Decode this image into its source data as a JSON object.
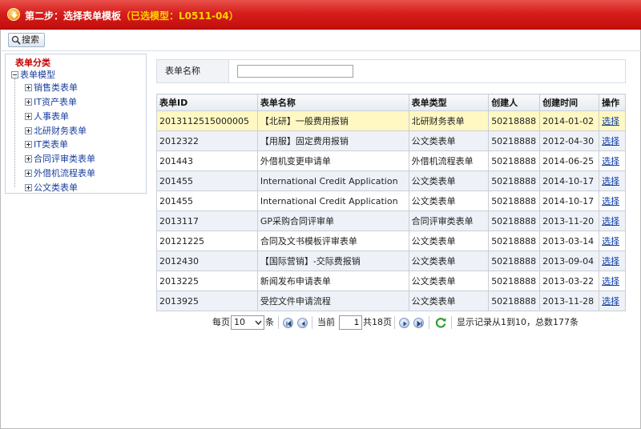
{
  "header": {
    "title": "第二步：选择表单模板",
    "selected_model": "（已选模型：L0511-04）"
  },
  "toolbar": {
    "search_label": "搜索"
  },
  "tree": {
    "title": "表单分类",
    "root": "表单模型",
    "items": [
      "销售类表单",
      "IT资产表单",
      "人事表单",
      "北研财务表单",
      "IT类表单",
      "合同评审类表单",
      "外借机流程表单",
      "公文类表单"
    ]
  },
  "filter": {
    "label": "表单名称",
    "value": ""
  },
  "table": {
    "columns": [
      "表单ID",
      "表单名称",
      "表单类型",
      "创建人",
      "创建时间",
      "操作"
    ],
    "rows": [
      {
        "id": "2013112515000005",
        "name": "【北研】一般费用报销",
        "type": "北研财务表单",
        "creator": "50218888",
        "time": "2014-01-02",
        "action": "选择"
      },
      {
        "id": "2012322",
        "name": "【用服】固定费用报销",
        "type": "公文类表单",
        "creator": "50218888",
        "time": "2012-04-30",
        "action": "选择"
      },
      {
        "id": "201443",
        "name": "外借机变更申请单",
        "type": "外借机流程表单",
        "creator": "50218888",
        "time": "2014-06-25",
        "action": "选择"
      },
      {
        "id": "201455",
        "name": "International Credit Application",
        "type": "公文类表单",
        "creator": "50218888",
        "time": "2014-10-17",
        "action": "选择"
      },
      {
        "id": "201455",
        "name": "International Credit Application",
        "type": "公文类表单",
        "creator": "50218888",
        "time": "2014-10-17",
        "action": "选择"
      },
      {
        "id": "2013117",
        "name": "GP采购合同评审单",
        "type": "合同评审类表单",
        "creator": "50218888",
        "time": "2013-11-20",
        "action": "选择"
      },
      {
        "id": "20121225",
        "name": "合同及文书模板评审表单",
        "type": "公文类表单",
        "creator": "50218888",
        "time": "2013-03-14",
        "action": "选择"
      },
      {
        "id": "2012430",
        "name": "【国际营销】-交际费报销",
        "type": "公文类表单",
        "creator": "50218888",
        "time": "2013-09-04",
        "action": "选择"
      },
      {
        "id": "2013225",
        "name": "新闻发布申请表单",
        "type": "公文类表单",
        "creator": "50218888",
        "time": "2013-03-22",
        "action": "选择"
      },
      {
        "id": "2013925",
        "name": "受控文件申请流程",
        "type": "公文类表单",
        "creator": "50218888",
        "time": "2013-11-28",
        "action": "选择"
      }
    ]
  },
  "pager": {
    "per_page_label": "每页",
    "page_size": "10",
    "unit": "条",
    "current_label": "当前",
    "current_page": "1",
    "total_pages_label": "共18页",
    "summary": "显示记录从1到10，总数177条"
  },
  "colors": {
    "title_bar": "#d61f1c",
    "title_highlight": "#ffd400",
    "tree_title": "#c60000",
    "link": "#0b3ca8",
    "selected_row": "#fff8c2"
  }
}
